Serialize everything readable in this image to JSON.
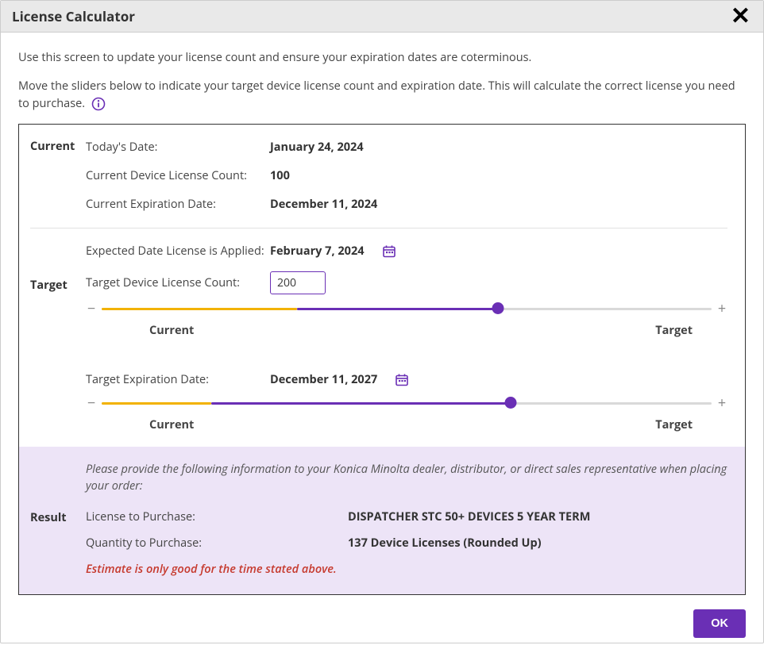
{
  "dialog": {
    "title": "License Calculator",
    "intro1": "Use this screen to update your license count and ensure your expiration dates are coterminous.",
    "intro2": "Move the sliders below to indicate your target device license count and expiration date. This will calculate the correct license you need to purchase."
  },
  "sections": {
    "current_label": "Current",
    "target_label": "Target",
    "result_label": "Result"
  },
  "current": {
    "today_label": "Today's Date:",
    "today_value": "January 24, 2024",
    "count_label": "Current Device License Count:",
    "count_value": "100",
    "expiry_label": "Current Expiration Date:",
    "expiry_value": "December 11, 2024"
  },
  "target": {
    "applied_label": "Expected Date License is Applied:",
    "applied_value": "February 7, 2024",
    "count_label": "Target Device License Count:",
    "count_value": "200",
    "expiry_label": "Target Expiration Date:",
    "expiry_value": "December 11, 2027"
  },
  "slider": {
    "current_label": "Current",
    "target_label": "Target"
  },
  "result": {
    "note": "Please provide the following information to your Konica Minolta dealer, distributor, or direct sales representative when placing your order:",
    "license_label": "License to Purchase:",
    "license_value": "DISPATCHER STC 50+ DEVICES 5 YEAR TERM",
    "qty_label": "Quantity to Purchase:",
    "qty_value": "137 Device Licenses (Rounded Up)",
    "disclaimer": "Estimate is only good for the time stated above."
  },
  "buttons": {
    "ok": "OK"
  },
  "colors": {
    "accent": "#6a2fb5",
    "slider_current": "#f2b200",
    "result_bg": "#ede4f7"
  }
}
